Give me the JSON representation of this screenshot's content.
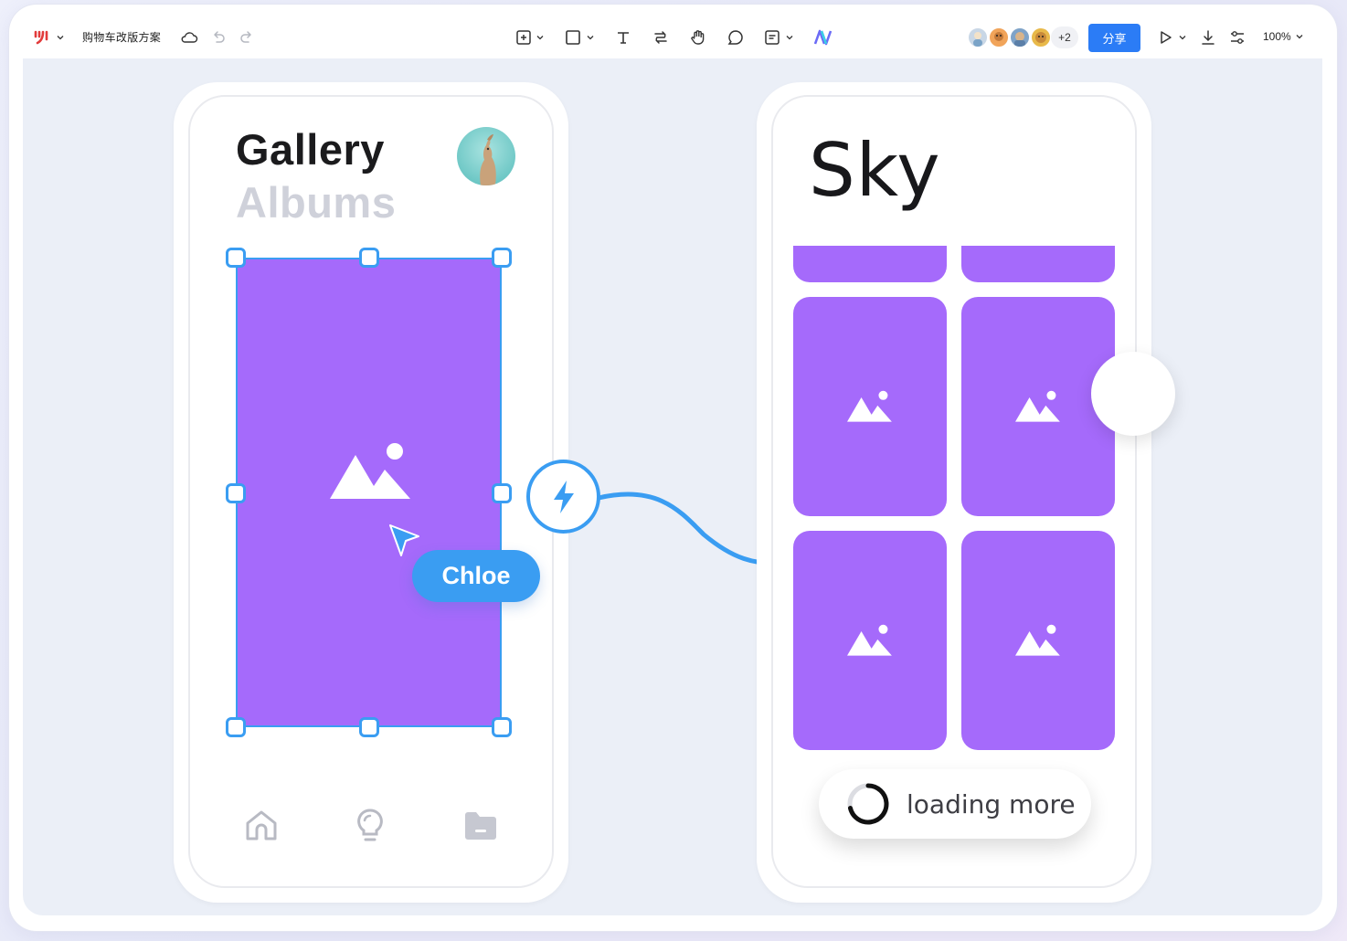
{
  "toolbar": {
    "logo_icon": "figma-style-logo-icon",
    "doc_title": "购物车改版方案",
    "share_label": "分享",
    "collaborators_extra": "+2",
    "zoom_label": "100%",
    "accent_color": "#2b7cf6",
    "tools": [
      "frame-icon",
      "shape-icon",
      "text-icon",
      "connector-icon",
      "hand-icon",
      "comment-icon",
      "note-icon",
      "ai-logo-icon"
    ]
  },
  "left_phone": {
    "title": "Gallery",
    "subtitle": "Albums",
    "cursor_user": "Chloe",
    "nav": [
      "home-icon",
      "bulb-icon",
      "folder-icon"
    ]
  },
  "right_phone": {
    "title": "Sky",
    "loading_label": "loading more"
  },
  "colors": {
    "tile": "#a56afb",
    "selection": "#3a9df2",
    "canvas": "#ebeff7"
  }
}
